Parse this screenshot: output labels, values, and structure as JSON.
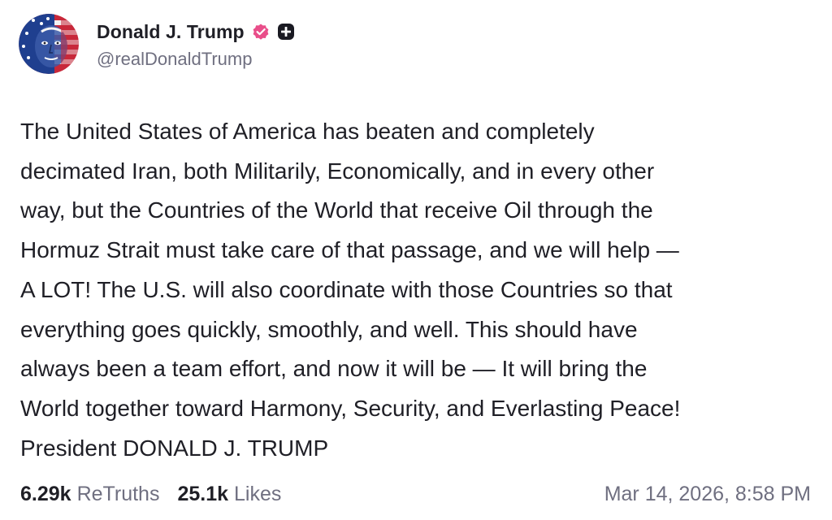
{
  "author": {
    "display_name": "Donald J. Trump",
    "handle": "@realDonaldTrump",
    "avatar_icon": "flag-portrait-avatar",
    "verified_icon": "verified-badge-icon",
    "verified_color": "#e94e8a",
    "plus_icon": "plus-badge-icon"
  },
  "post": {
    "text_lines": [
      "The United States of America has beaten and completely",
      "decimated Iran, both Militarily, Economically, and in every other",
      "way, but the Countries of the World that receive Oil through the",
      "Hormuz Strait must take care of that passage, and we will help —",
      "A LOT! The U.S. will also coordinate with those Countries so that",
      "everything goes quickly, smoothly, and well. This should have",
      "always been a team effort, and now it will be — It will bring the",
      "World together toward Harmony, Security, and Everlasting Peace!",
      "President DONALD J. TRUMP"
    ]
  },
  "stats": {
    "retruths_count": "6.29k",
    "retruths_label": "ReTruths",
    "likes_count": "25.1k",
    "likes_label": "Likes"
  },
  "timestamp": "Mar 14, 2026, 8:58 PM"
}
